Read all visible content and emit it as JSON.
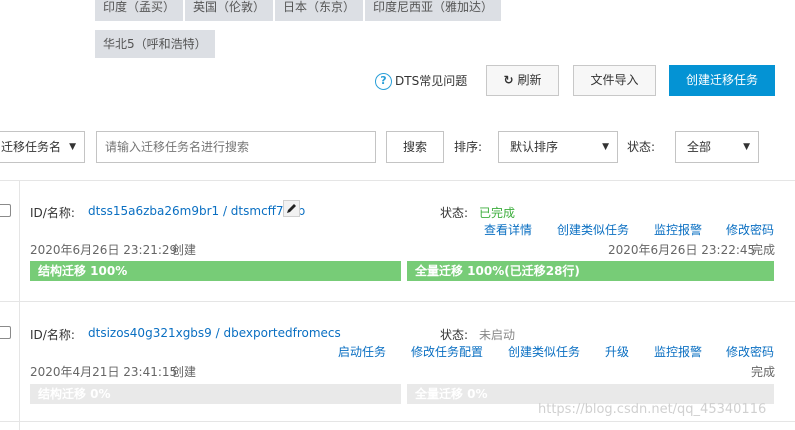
{
  "regions": [
    "印度（孟买）",
    "英国（伦敦）",
    "日本（东京）",
    "印度尼西亚（雅加达）",
    "华北5（呼和浩特）"
  ],
  "toolbar": {
    "help_label": "DTS常见问题",
    "help_icon": "question-circle-icon",
    "refresh_label": "刷新",
    "refresh_icon": "refresh-icon",
    "import_label": "文件导入",
    "create_label": "创建迁移任务"
  },
  "filter": {
    "field_select": "迁移任务名",
    "search_placeholder": "请输入迁移任务名进行搜索",
    "search_button": "搜索",
    "sort_label": "排序:",
    "sort_value": "默认排序",
    "status_label": "状态:",
    "status_value": "全部"
  },
  "tasks": [
    {
      "id_label": "ID/名称:",
      "id_name": "dtss15a6zba26m9br1 / dtsmcff7oxb",
      "created_time": "2020年6月26日 23:21:29",
      "created_label": "创建",
      "status_label": "状态:",
      "status_value": "已完成",
      "actions": [
        "查看详情",
        "创建类似任务",
        "监控报警",
        "修改密码"
      ],
      "finished_time": "2020年6月26日 23:22:45",
      "finished_label": "完成",
      "struct_progress": "结构迁移  100%",
      "full_progress": "全量迁移  100%(已迁移28行)",
      "struct_fraction": 1.0,
      "full_fraction": 1.0
    },
    {
      "id_label": "ID/名称:",
      "id_name": "dtsizos40g321xgbs9 / dbexportedfromecs",
      "created_time": "2020年4月21日 23:41:15",
      "created_label": "创建",
      "status_label": "状态:",
      "status_value": "未启动",
      "actions": [
        "启动任务",
        "修改任务配置",
        "创建类似任务",
        "升级",
        "监控报警",
        "修改密码"
      ],
      "finished_label": "完成",
      "struct_progress": "结构迁移  0%",
      "full_progress": "全量迁移  0%",
      "struct_fraction": 0,
      "full_fraction": 0
    }
  ],
  "colors": {
    "primary": "#0493d4",
    "link": "#0a6fc2",
    "success": "#3dae3d",
    "progress_done": "#77cc77",
    "progress_idle": "#e9e9e9"
  },
  "watermark": "https://blog.csdn.net/qq_45340116"
}
